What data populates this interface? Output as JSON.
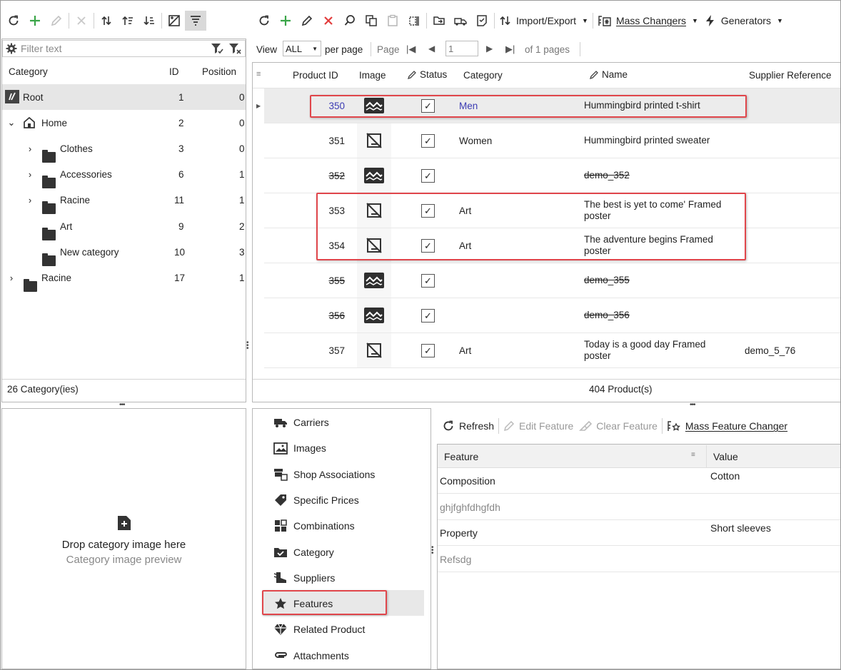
{
  "left_toolbar": {
    "buttons": [
      "refresh-icon",
      "add-icon",
      "edit-icon",
      "delete-icon",
      "move-up-down-icon",
      "sort-up-icon",
      "sort-down-icon",
      "image-icon",
      "filter-active-icon"
    ]
  },
  "main_toolbar": {
    "import_export_label": "Import/Export",
    "mass_changers_label": "Mass Changers",
    "generators_label": "Generators"
  },
  "tree": {
    "filter_placeholder": "Filter text",
    "columns": {
      "category": "Category",
      "id": "ID",
      "position": "Position"
    },
    "rows": [
      {
        "name": "Root",
        "id": "1",
        "position": "0"
      },
      {
        "name": "Home",
        "id": "2",
        "position": "0"
      },
      {
        "name": "Clothes",
        "id": "3",
        "position": "0"
      },
      {
        "name": "Accessories",
        "id": "6",
        "position": "1"
      },
      {
        "name": "Racine",
        "id": "11",
        "position": "1"
      },
      {
        "name": "Art",
        "id": "9",
        "position": "2"
      },
      {
        "name": "New category",
        "id": "10",
        "position": "3"
      },
      {
        "name": "Racine",
        "id": "17",
        "position": "1"
      }
    ],
    "footer": "26 Category(ies)"
  },
  "pager": {
    "view_label": "View",
    "view_value": "ALL",
    "per_page_label": "per page",
    "page_label": "Page",
    "page_value": "1",
    "of_pages": "of 1 pages"
  },
  "products": {
    "columns": {
      "id": "Product ID",
      "image": "Image",
      "status": "Status",
      "category": "Category",
      "name": "Name",
      "supplier_ref": "Supplier Reference"
    },
    "rows": [
      {
        "id": "350",
        "category": "Men",
        "name": "Hummingbird printed t-shirt",
        "name2": "",
        "ref": ""
      },
      {
        "id": "351",
        "category": "Women",
        "name": "Hummingbird printed sweater",
        "name2": "",
        "ref": ""
      },
      {
        "id": "352",
        "category": "",
        "name": "demo_352",
        "name2": "",
        "ref": ""
      },
      {
        "id": "353",
        "category": "Art",
        "name": "The best is yet to come' Framed",
        "name2": "poster",
        "ref": ""
      },
      {
        "id": "354",
        "category": "Art",
        "name": "The adventure begins Framed",
        "name2": "poster",
        "ref": ""
      },
      {
        "id": "355",
        "category": "",
        "name": "demo_355",
        "name2": "",
        "ref": ""
      },
      {
        "id": "356",
        "category": "",
        "name": "demo_356",
        "name2": "",
        "ref": ""
      },
      {
        "id": "357",
        "category": "Art",
        "name": "Today is a good day Framed",
        "name2": "poster",
        "ref": "demo_5_76"
      }
    ],
    "footer": "404 Product(s)"
  },
  "dropzone": {
    "title": "Drop category image here",
    "subtitle": "Category image preview"
  },
  "detail_nav": [
    {
      "label": "Carriers",
      "icon": "truck-icon"
    },
    {
      "label": "Images",
      "icon": "picture-icon"
    },
    {
      "label": "Shop Associations",
      "icon": "shop-icon"
    },
    {
      "label": "Specific Prices",
      "icon": "price-tag-icon"
    },
    {
      "label": "Combinations",
      "icon": "grid-icon"
    },
    {
      "label": "Category",
      "icon": "folder-check-icon"
    },
    {
      "label": "Suppliers",
      "icon": "boot-icon"
    },
    {
      "label": "Features",
      "icon": "star-icon"
    },
    {
      "label": "Related Product",
      "icon": "diamond-icon"
    },
    {
      "label": "Attachments",
      "icon": "paperclip-icon"
    }
  ],
  "features_toolbar": {
    "refresh": "Refresh",
    "edit": "Edit Feature",
    "clear": "Clear Feature",
    "mass": "Mass Feature Changer"
  },
  "features": {
    "columns": {
      "feature": "Feature",
      "value": "Value"
    },
    "rows": [
      {
        "feature": "Composition",
        "value": "Cotton"
      },
      {
        "feature": "ghjfghfdhgfdh",
        "value": ""
      },
      {
        "feature": "Property",
        "value": "Short sleeves"
      },
      {
        "feature": "Refsdg",
        "value": ""
      }
    ]
  },
  "colors": {
    "accent_red": "#e0464b",
    "add_green": "#3aa548",
    "delete_red": "#e23c3c",
    "link_blue": "#3b3bb3"
  }
}
